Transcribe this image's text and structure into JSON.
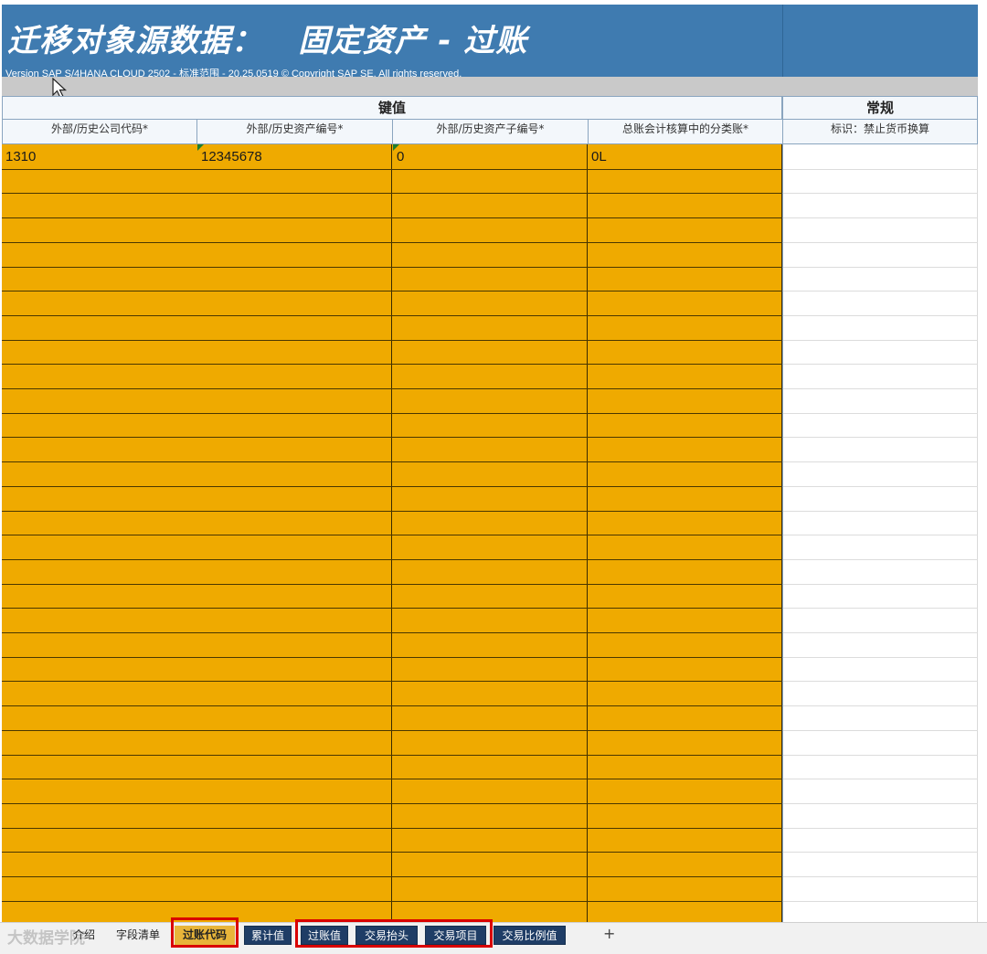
{
  "header": {
    "title": "迁移对象源数据：   固定资产 - 过账",
    "subtitle": "Version SAP S/4HANA CLOUD 2502 - 标准范围 - 20.25.0519 © Copyright SAP SE. All rights reserved."
  },
  "groups": {
    "key": "键值",
    "general": "常规"
  },
  "columns": [
    "外部/历史公司代码*",
    "外部/历史资产编号*",
    "外部/历史资产子编号*",
    "总账会计核算中的分类账*",
    "标识：禁止货币换算"
  ],
  "rows": [
    [
      "1310",
      "12345678",
      "0",
      "0L",
      ""
    ]
  ],
  "tabs": [
    {
      "label": "介绍"
    },
    {
      "label": "字段清单"
    },
    {
      "label": "过账代码"
    },
    {
      "label": "累计值"
    },
    {
      "label": "过账值"
    },
    {
      "label": "交易抬头"
    },
    {
      "label": "交易项目"
    },
    {
      "label": "交易比例值"
    }
  ],
  "add_sheet": "+",
  "watermark": "大数据学院",
  "colors": {
    "banner": "#3f7bb0",
    "cell_fill": "#efaa00",
    "tab_dark": "#1f3d66",
    "highlight": "#d90000"
  }
}
